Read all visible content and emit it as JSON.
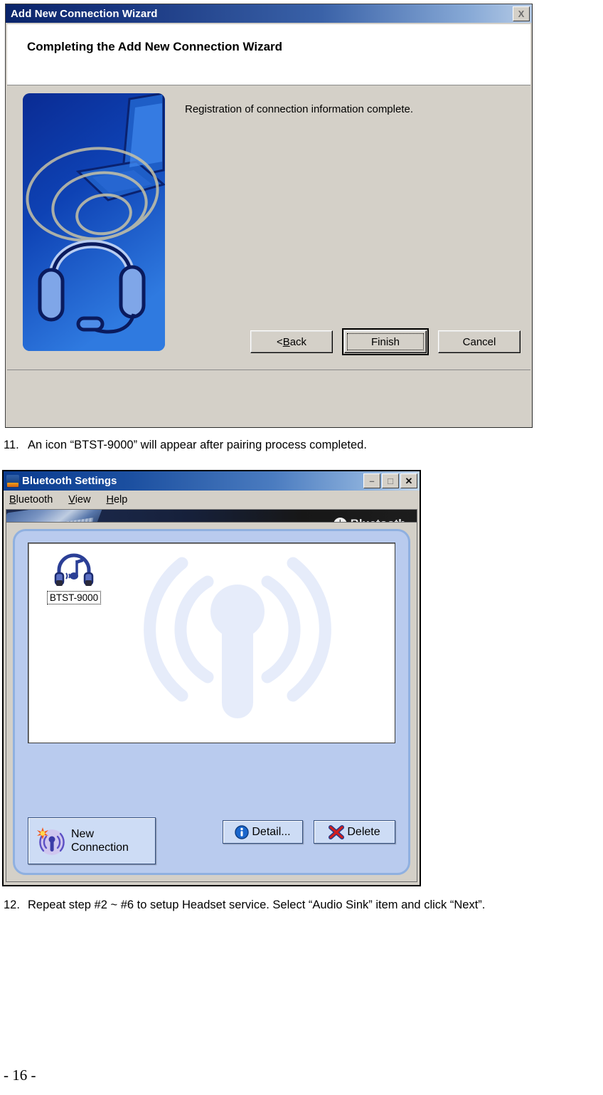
{
  "wizard": {
    "title": "Add New Connection Wizard",
    "close_label": "X",
    "heading": "Completing the Add New Connection Wizard",
    "body_text": "Registration of connection information complete.",
    "buttons": {
      "back": "< Back",
      "back_prefix": "< ",
      "back_accel": "B",
      "back_rest": "ack",
      "finish": "Finish",
      "cancel": "Cancel"
    },
    "art_name": "headset-laptop-illustration"
  },
  "steps": [
    {
      "number": "11.",
      "text": "An icon “BTST-9000” will appear after pairing process completed."
    },
    {
      "number": "12.",
      "text": "Repeat step #2 ~ #6 to setup Headset service. Select “Audio Sink” item and click “Next”."
    }
  ],
  "bluetooth_window": {
    "title": "Bluetooth Settings",
    "title_buttons": {
      "minimize": "–",
      "maximize": "□",
      "close": "✕"
    },
    "menu": [
      {
        "accel": "B",
        "rest": "luetooth",
        "label": "Bluetooth"
      },
      {
        "accel": "V",
        "rest": "iew",
        "label": "View"
      },
      {
        "accel": "H",
        "rest": "elp",
        "label": "Help"
      }
    ],
    "banner": {
      "logo_text": "Bluetooth",
      "logo_tm": "®",
      "logo_mark": "ᛦ"
    },
    "devices": [
      {
        "name": "BTST-9000",
        "icon": "headset-music-icon",
        "selected": true
      }
    ],
    "buttons": {
      "new_connection_line1": "New",
      "new_connection_line2": "Connection",
      "detail": "Detail...",
      "delete": "Delete"
    }
  },
  "footer": {
    "page_number": "- 16 -"
  },
  "colors": {
    "title_blue": "#0a246a",
    "dialog_face": "#d4d0c8",
    "panel_blue": "#b9cbee",
    "panel_border": "#8fb0e0",
    "button_face": "#cddcf5",
    "watermark_blue": "#e6ecfa",
    "accent_red": "#cc2222",
    "accent_info": "#1a66cc"
  }
}
